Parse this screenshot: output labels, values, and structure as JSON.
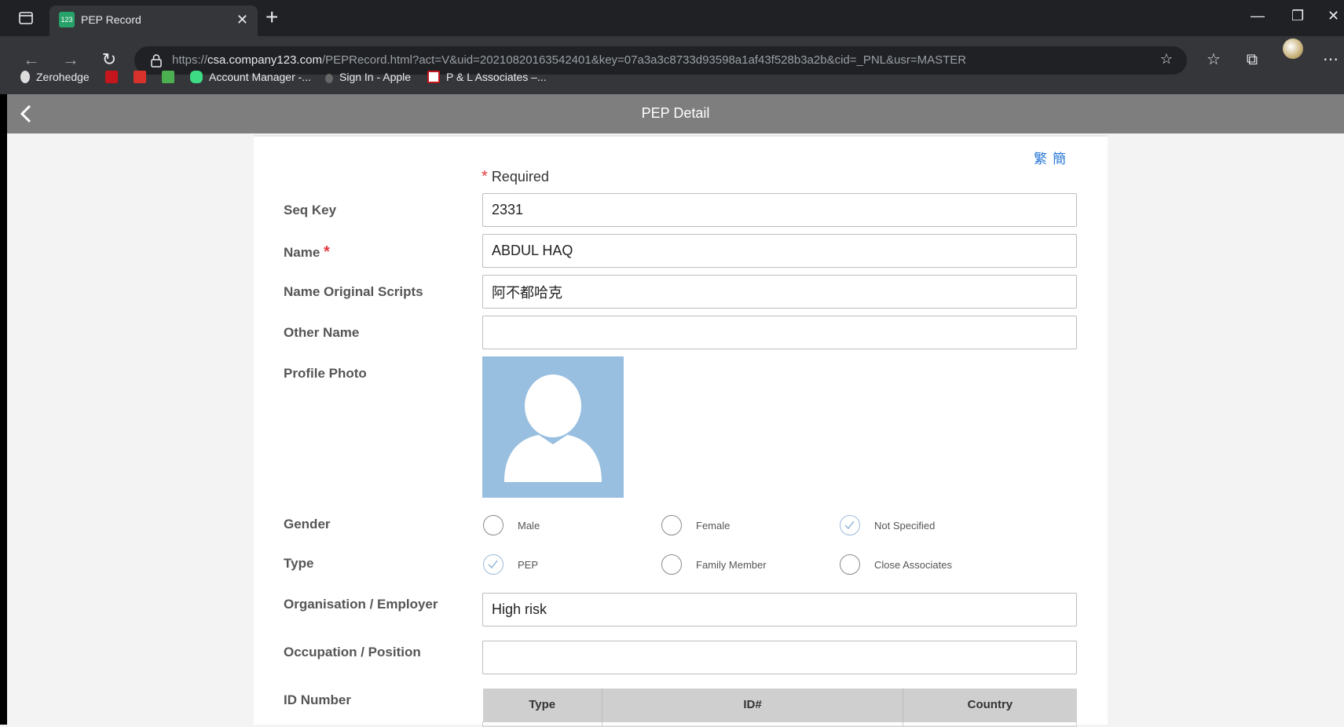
{
  "browser": {
    "tab_title": "PEP Record",
    "tab_favicon_text": "123",
    "url_scheme": "https://",
    "url_host": "csa.company123.com",
    "url_path": "/PEPRecord.html?act=V&uid=20210820163542401&key=07a3a3c8733d93598a1af43f528b3a2b&cid=_PNL&usr=MASTER",
    "bookmarks": [
      {
        "label": "Zerohedge"
      },
      {
        "label": ""
      },
      {
        "label": ""
      },
      {
        "label": ""
      },
      {
        "label": "Account Manager -..."
      },
      {
        "label": "Sign In - Apple"
      },
      {
        "label": "P & L Associates –..."
      }
    ]
  },
  "header": {
    "title": "PEP Detail"
  },
  "form": {
    "lang_traditional": "繁",
    "lang_simplified": "簡",
    "required_note": "Required",
    "required_marker": "*",
    "fields": {
      "seq_key": {
        "label": "Seq Key",
        "value": "2331"
      },
      "name": {
        "label": "Name",
        "value": "ABDUL HAQ"
      },
      "name_original": {
        "label": "Name Original Scripts",
        "value": "阿不都哈克"
      },
      "other_name": {
        "label": "Other Name",
        "value": ""
      },
      "profile_photo": {
        "label": "Profile Photo"
      },
      "organisation": {
        "label": "Organisation / Employer",
        "value": "High risk"
      },
      "occupation": {
        "label": "Occupation / Position",
        "value": ""
      },
      "id_number": {
        "label": "ID Number"
      }
    },
    "gender": {
      "label": "Gender",
      "options": [
        "Male",
        "Female",
        "Not Specified"
      ],
      "selected": "Not Specified"
    },
    "type": {
      "label": "Type",
      "options": [
        "PEP",
        "Family Member",
        "Close Associates"
      ],
      "selected": "PEP"
    },
    "id_table": {
      "columns": [
        "Type",
        "ID#",
        "Country"
      ]
    }
  }
}
